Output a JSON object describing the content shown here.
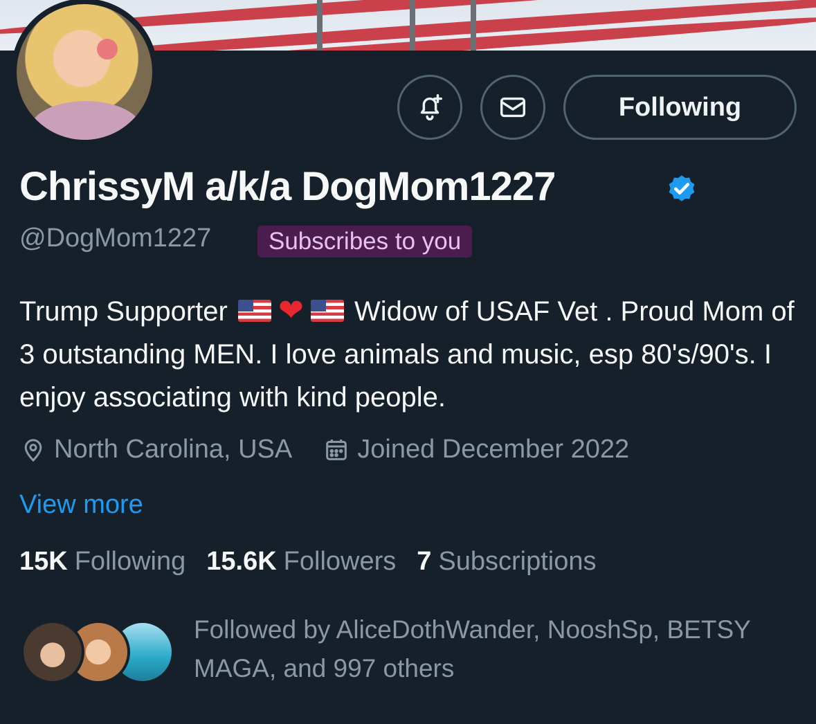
{
  "profile": {
    "display_name": "ChrissyM a/k/a DogMom1227",
    "handle": "@DogMom1227",
    "subscribes_badge": "Subscribes to you",
    "bio_part1": "Trump Supporter",
    "bio_part2": "Widow of USAF Vet . Proud Mom of 3 outstanding MEN. I love animals and music, esp 80's/90's. I enjoy associating with kind people.",
    "location": "North Carolina, USA",
    "joined": "Joined December 2022",
    "view_more": "View more"
  },
  "actions": {
    "follow_label": "Following"
  },
  "stats": {
    "following_count": "15K",
    "following_label": "Following",
    "followers_count": "15.6K",
    "followers_label": "Followers",
    "subscriptions_count": "7",
    "subscriptions_label": "Subscriptions"
  },
  "followed_by": {
    "text": "Followed by AliceDothWander, NooshSp, BETSY MAGA, and 997 others"
  },
  "colors": {
    "background": "#15202b",
    "accent_blue": "#1d9bf0",
    "muted_text": "#8b98a5",
    "badge_bg": "#4a1d4e"
  },
  "icons": {
    "notify": "bell-plus-icon",
    "message": "envelope-icon",
    "verified": "verified-badge-icon",
    "location": "location-pin-icon",
    "calendar": "calendar-icon"
  }
}
